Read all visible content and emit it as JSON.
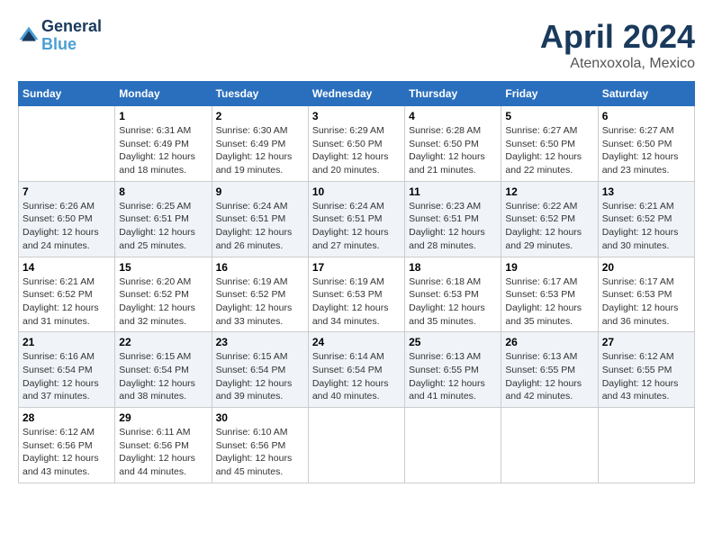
{
  "logo": {
    "line1": "General",
    "line2": "Blue"
  },
  "title": "April 2024",
  "location": "Atenxoxola, Mexico",
  "weekdays": [
    "Sunday",
    "Monday",
    "Tuesday",
    "Wednesday",
    "Thursday",
    "Friday",
    "Saturday"
  ],
  "weeks": [
    [
      {
        "day": "",
        "info": ""
      },
      {
        "day": "1",
        "info": "Sunrise: 6:31 AM\nSunset: 6:49 PM\nDaylight: 12 hours\nand 18 minutes."
      },
      {
        "day": "2",
        "info": "Sunrise: 6:30 AM\nSunset: 6:49 PM\nDaylight: 12 hours\nand 19 minutes."
      },
      {
        "day": "3",
        "info": "Sunrise: 6:29 AM\nSunset: 6:50 PM\nDaylight: 12 hours\nand 20 minutes."
      },
      {
        "day": "4",
        "info": "Sunrise: 6:28 AM\nSunset: 6:50 PM\nDaylight: 12 hours\nand 21 minutes."
      },
      {
        "day": "5",
        "info": "Sunrise: 6:27 AM\nSunset: 6:50 PM\nDaylight: 12 hours\nand 22 minutes."
      },
      {
        "day": "6",
        "info": "Sunrise: 6:27 AM\nSunset: 6:50 PM\nDaylight: 12 hours\nand 23 minutes."
      }
    ],
    [
      {
        "day": "7",
        "info": "Sunrise: 6:26 AM\nSunset: 6:50 PM\nDaylight: 12 hours\nand 24 minutes."
      },
      {
        "day": "8",
        "info": "Sunrise: 6:25 AM\nSunset: 6:51 PM\nDaylight: 12 hours\nand 25 minutes."
      },
      {
        "day": "9",
        "info": "Sunrise: 6:24 AM\nSunset: 6:51 PM\nDaylight: 12 hours\nand 26 minutes."
      },
      {
        "day": "10",
        "info": "Sunrise: 6:24 AM\nSunset: 6:51 PM\nDaylight: 12 hours\nand 27 minutes."
      },
      {
        "day": "11",
        "info": "Sunrise: 6:23 AM\nSunset: 6:51 PM\nDaylight: 12 hours\nand 28 minutes."
      },
      {
        "day": "12",
        "info": "Sunrise: 6:22 AM\nSunset: 6:52 PM\nDaylight: 12 hours\nand 29 minutes."
      },
      {
        "day": "13",
        "info": "Sunrise: 6:21 AM\nSunset: 6:52 PM\nDaylight: 12 hours\nand 30 minutes."
      }
    ],
    [
      {
        "day": "14",
        "info": "Sunrise: 6:21 AM\nSunset: 6:52 PM\nDaylight: 12 hours\nand 31 minutes."
      },
      {
        "day": "15",
        "info": "Sunrise: 6:20 AM\nSunset: 6:52 PM\nDaylight: 12 hours\nand 32 minutes."
      },
      {
        "day": "16",
        "info": "Sunrise: 6:19 AM\nSunset: 6:52 PM\nDaylight: 12 hours\nand 33 minutes."
      },
      {
        "day": "17",
        "info": "Sunrise: 6:19 AM\nSunset: 6:53 PM\nDaylight: 12 hours\nand 34 minutes."
      },
      {
        "day": "18",
        "info": "Sunrise: 6:18 AM\nSunset: 6:53 PM\nDaylight: 12 hours\nand 35 minutes."
      },
      {
        "day": "19",
        "info": "Sunrise: 6:17 AM\nSunset: 6:53 PM\nDaylight: 12 hours\nand 35 minutes."
      },
      {
        "day": "20",
        "info": "Sunrise: 6:17 AM\nSunset: 6:53 PM\nDaylight: 12 hours\nand 36 minutes."
      }
    ],
    [
      {
        "day": "21",
        "info": "Sunrise: 6:16 AM\nSunset: 6:54 PM\nDaylight: 12 hours\nand 37 minutes."
      },
      {
        "day": "22",
        "info": "Sunrise: 6:15 AM\nSunset: 6:54 PM\nDaylight: 12 hours\nand 38 minutes."
      },
      {
        "day": "23",
        "info": "Sunrise: 6:15 AM\nSunset: 6:54 PM\nDaylight: 12 hours\nand 39 minutes."
      },
      {
        "day": "24",
        "info": "Sunrise: 6:14 AM\nSunset: 6:54 PM\nDaylight: 12 hours\nand 40 minutes."
      },
      {
        "day": "25",
        "info": "Sunrise: 6:13 AM\nSunset: 6:55 PM\nDaylight: 12 hours\nand 41 minutes."
      },
      {
        "day": "26",
        "info": "Sunrise: 6:13 AM\nSunset: 6:55 PM\nDaylight: 12 hours\nand 42 minutes."
      },
      {
        "day": "27",
        "info": "Sunrise: 6:12 AM\nSunset: 6:55 PM\nDaylight: 12 hours\nand 43 minutes."
      }
    ],
    [
      {
        "day": "28",
        "info": "Sunrise: 6:12 AM\nSunset: 6:56 PM\nDaylight: 12 hours\nand 43 minutes."
      },
      {
        "day": "29",
        "info": "Sunrise: 6:11 AM\nSunset: 6:56 PM\nDaylight: 12 hours\nand 44 minutes."
      },
      {
        "day": "30",
        "info": "Sunrise: 6:10 AM\nSunset: 6:56 PM\nDaylight: 12 hours\nand 45 minutes."
      },
      {
        "day": "",
        "info": ""
      },
      {
        "day": "",
        "info": ""
      },
      {
        "day": "",
        "info": ""
      },
      {
        "day": "",
        "info": ""
      }
    ]
  ]
}
